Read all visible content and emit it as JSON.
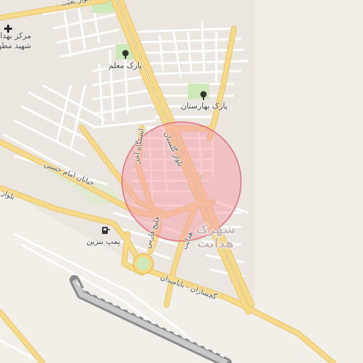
{
  "map": {
    "poi": {
      "hospital": "مرکز بهداشت شهید مطهری",
      "hospital_line1": "مرکز بهداشت",
      "hospital_line2": "شهید مطهری",
      "park_moallem": "پارک معلم",
      "park_baharestan": "پارک بهارستان",
      "gas_station": "پمپ بنزین"
    },
    "roads": {
      "top": "بلوار بعثت",
      "imam_hossein": "خیابان امام حسین",
      "left_blvd": "بلوار",
      "golestan": "بلوار گلستان",
      "istgah": "ایستگاه آخر",
      "khalij": "خلیج فارس",
      "hedayat_st": "هدایت",
      "gachsaran": "گچساران - بابامیدان"
    },
    "neighborhood": {
      "line1": "شهرک",
      "line2": "هدایت"
    },
    "icons": {
      "hospital": "cross-icon",
      "park": "tree-icon",
      "fuel": "fuel-pump-icon"
    },
    "colors": {
      "background": "#f2efe9",
      "major_road": "#f7d98a",
      "minor_road": "#ffffff",
      "park": "#cde8b9",
      "runway": "#9a9a9a",
      "circle_fill": "#f4a3ab",
      "circle_stroke": "#e0707c"
    }
  }
}
